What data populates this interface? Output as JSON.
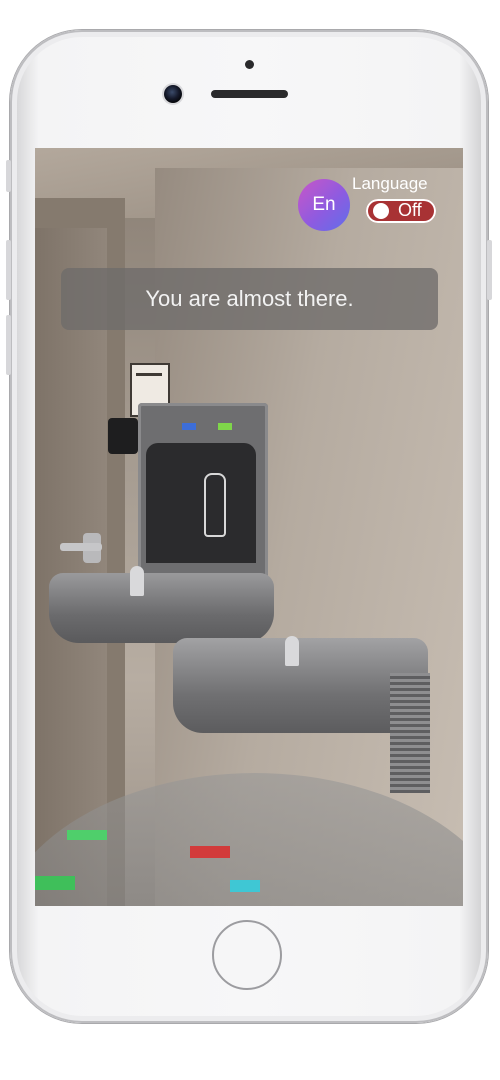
{
  "language": {
    "code": "En",
    "label": "Language",
    "toggle_state": "Off",
    "toggle_color": "#a83234"
  },
  "navigation": {
    "message": "You are almost there."
  },
  "colors": {
    "avatar_gradient_start": "#c857c7",
    "avatar_gradient_end": "#5f6fea",
    "banner_background": "rgba(110,108,106,0.78)"
  },
  "icons": {
    "front_camera": "camera-icon",
    "speaker": "speaker-icon",
    "home": "home-button-icon"
  }
}
